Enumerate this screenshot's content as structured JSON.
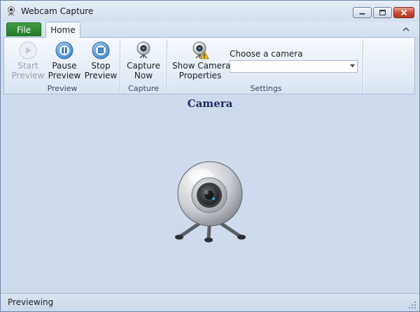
{
  "window": {
    "title": "Webcam Capture"
  },
  "tabs": {
    "file": "File",
    "home": "Home"
  },
  "ribbon": {
    "preview": {
      "label": "Preview",
      "start": {
        "line1": "Start",
        "line2": "Preview",
        "enabled": false
      },
      "pause": {
        "line1": "Pause",
        "line2": "Preview"
      },
      "stop": {
        "line1": "Stop",
        "line2": "Preview"
      }
    },
    "capture": {
      "label": "Capture",
      "now": {
        "line1": "Capture",
        "line2": "Now"
      }
    },
    "settings": {
      "label": "Settings",
      "properties": {
        "line1": "Show Camera",
        "line2": "Properties"
      },
      "camera_label": "Choose a camera",
      "camera_value": ""
    }
  },
  "main": {
    "heading": "Camera"
  },
  "status": {
    "text": "Previewing"
  },
  "colors": {
    "file_tab": "#2f8a35",
    "heading": "#1e2b66",
    "close_button": "#c9462f",
    "workspace": "#cfdbec"
  },
  "icons": [
    "webcam-icon",
    "play-icon",
    "pause-icon",
    "stop-icon",
    "warning-icon",
    "chevron-down-icon",
    "minimize-icon",
    "maximize-icon",
    "close-icon",
    "chevron-up-icon",
    "resize-grip-icon"
  ]
}
